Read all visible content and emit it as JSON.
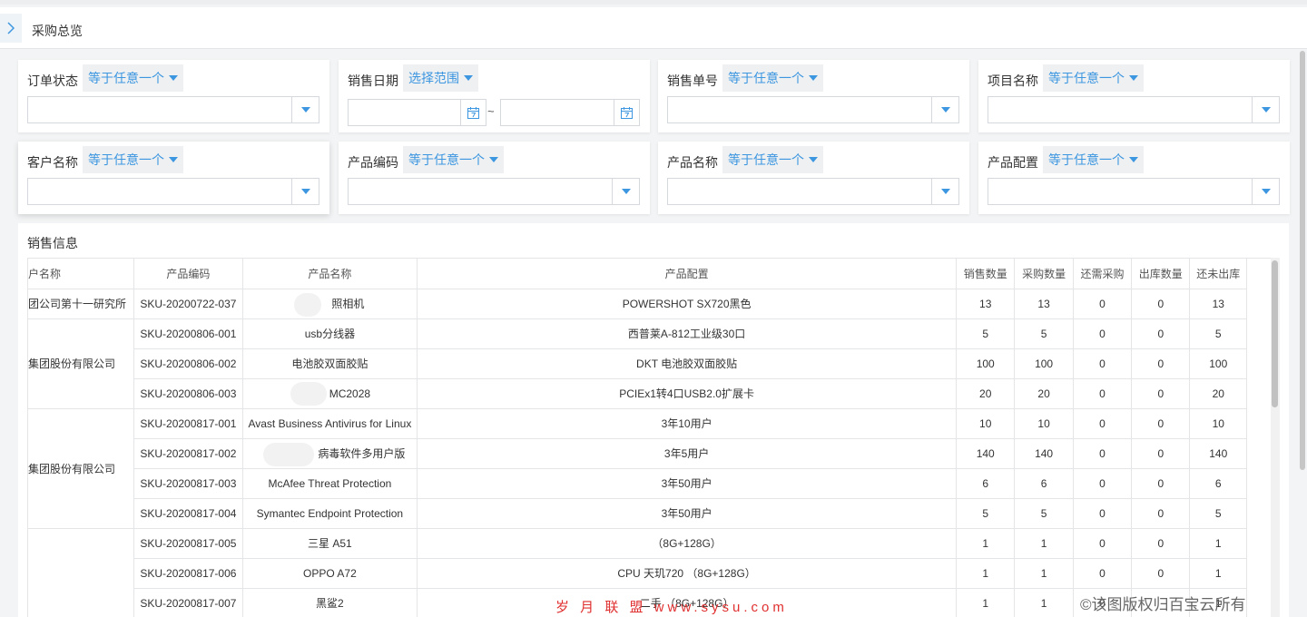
{
  "page": {
    "title": "采购总览"
  },
  "filters": [
    {
      "label": "订单状态",
      "op": "等于任意一个"
    },
    {
      "label": "销售日期",
      "op": "选择范围"
    },
    {
      "label": "销售单号",
      "op": "等于任意一个"
    },
    {
      "label": "项目名称",
      "op": "等于任意一个"
    },
    {
      "label": "客户名称",
      "op": "等于任意一个"
    },
    {
      "label": "产品编码",
      "op": "等于任意一个"
    },
    {
      "label": "产品名称",
      "op": "等于任意一个"
    },
    {
      "label": "产品配置",
      "op": "等于任意一个"
    }
  ],
  "date_separator": "~",
  "sales": {
    "title": "销售信息",
    "columns": [
      "户名称",
      "产品编码",
      "产品名称",
      "产品配置",
      "销售数量",
      "采购数量",
      "还需采购",
      "出库数量",
      "还未出库"
    ],
    "customers": [
      "团公司第十一研究所",
      "集团股份有限公司",
      "集团股份有限公司",
      ""
    ],
    "rows": [
      [
        "SKU-20200722-037",
        "照相机",
        "POWERSHOT SX720黑色",
        "13",
        "13",
        "0",
        "0",
        "13"
      ],
      [
        "SKU-20200806-001",
        "usb分线器",
        "西普莱A-812工业级30口",
        "5",
        "5",
        "0",
        "0",
        "5"
      ],
      [
        "SKU-20200806-002",
        "电池胶双面胶贴",
        "DKT 电池胶双面胶贴",
        "100",
        "100",
        "0",
        "0",
        "100"
      ],
      [
        "SKU-20200806-003",
        "MC2028",
        "PCIEx1转4口USB2.0扩展卡",
        "20",
        "20",
        "0",
        "0",
        "20"
      ],
      [
        "SKU-20200817-001",
        "Avast Business Antivirus for Linux",
        "3年10用户",
        "10",
        "10",
        "0",
        "0",
        "10"
      ],
      [
        "SKU-20200817-002",
        "病毒软件多用户版",
        "3年5用户",
        "140",
        "140",
        "0",
        "0",
        "140"
      ],
      [
        "SKU-20200817-003",
        "McAfee Threat Protection",
        "3年50用户",
        "6",
        "6",
        "0",
        "0",
        "6"
      ],
      [
        "SKU-20200817-004",
        "Symantec Endpoint Protection",
        "3年50用户",
        "5",
        "5",
        "0",
        "0",
        "5"
      ],
      [
        "SKU-20200817-005",
        "三星 A51",
        "（8G+128G）",
        "1",
        "1",
        "0",
        "0",
        "1"
      ],
      [
        "SKU-20200817-006",
        "OPPO A72",
        "CPU 天玑720 （8G+128G）",
        "1",
        "1",
        "0",
        "0",
        "1"
      ],
      [
        "SKU-20200817-007",
        "黑鲨2",
        "二手 （8G+128G）",
        "1",
        "1",
        "0",
        "",
        "1"
      ]
    ]
  },
  "watermarks": {
    "site": "岁 月 联 盟 www.sysu.com",
    "copyright": "©该图版权归百宝云所有"
  },
  "colors": {
    "accent": "#3c96e0",
    "border": "#e3e5e7",
    "background": "#f3f4f5"
  }
}
